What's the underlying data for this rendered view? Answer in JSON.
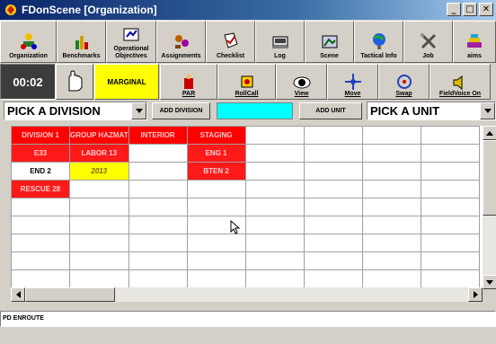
{
  "window": {
    "title": "FDonScene [Organization]"
  },
  "toolbar": [
    {
      "label": "Organization",
      "icon": "organization-icon"
    },
    {
      "label": "Benchmarks",
      "icon": "benchmarks-icon"
    },
    {
      "label": "Operational Objectives",
      "icon": "objectives-icon"
    },
    {
      "label": "Assignments",
      "icon": "assignments-icon"
    },
    {
      "label": "Checklist",
      "icon": "checklist-icon"
    },
    {
      "label": "Log",
      "icon": "log-icon"
    },
    {
      "label": "Scene",
      "icon": "scene-icon"
    },
    {
      "label": "Tactical Info",
      "icon": "tactical-info-icon"
    },
    {
      "label": "Job",
      "icon": "job-icon"
    },
    {
      "label": "aims",
      "icon": "aims-icon"
    }
  ],
  "bar2": {
    "timer": "00:02",
    "marginal": "MARGINAL",
    "par": "PAR",
    "rollcall": "RollCall",
    "view": "View",
    "move": "Move",
    "swap": "Swap",
    "fieldvoice": "FieldVoice On"
  },
  "picker": {
    "division": "PICK A DIVISION",
    "add_division": "ADD DIVISION",
    "add_unit": "ADD UNIT",
    "unit": "PICK A UNIT"
  },
  "grid": {
    "headers": [
      "DIVISION 1",
      "GROUP HAZMAT",
      "INTERIOR",
      "STAGING"
    ],
    "rows": [
      [
        {
          "t": "E33",
          "c": "red"
        },
        {
          "t": "LABOR 13",
          "c": "red"
        },
        {
          "t": "",
          "c": "white"
        },
        {
          "t": "ENG 1",
          "c": "red"
        }
      ],
      [
        {
          "t": "END 2",
          "c": "white"
        },
        {
          "t": "2013",
          "c": "yellow"
        },
        {
          "t": "",
          "c": "white"
        },
        {
          "t": "BTEN 2",
          "c": "red"
        }
      ],
      [
        {
          "t": "RESCUE 28",
          "c": "red"
        },
        {
          "t": "",
          "c": "white"
        },
        {
          "t": "",
          "c": "white"
        },
        {
          "t": "",
          "c": "white"
        }
      ]
    ]
  },
  "status": {
    "text": "PD ENROUTE"
  },
  "colors": {
    "unit_red": "#ff1a1a",
    "warning_yellow": "#ffff00",
    "cyan": "#00ffff",
    "titlebar": "#0a246a"
  }
}
